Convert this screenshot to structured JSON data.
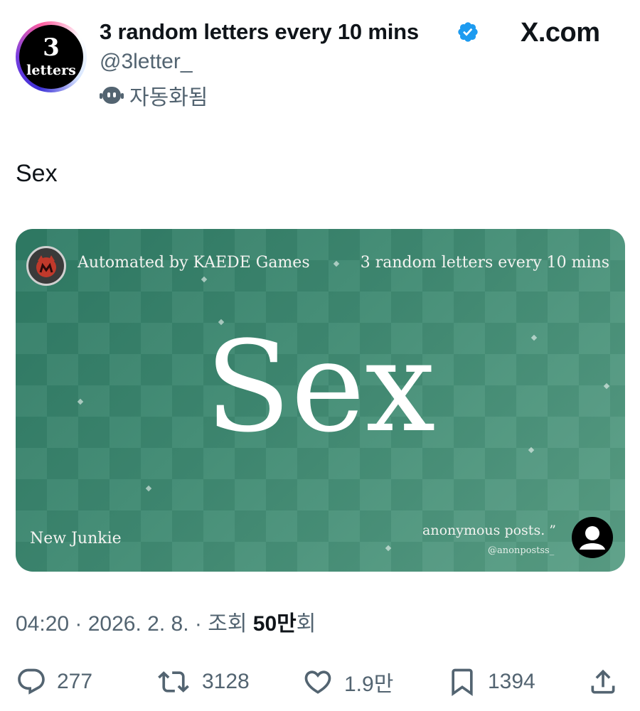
{
  "header": {
    "avatar_number": "3",
    "avatar_word": "letters",
    "display_name": "3 random letters every 10 mins",
    "handle": "@3letter_",
    "automated_label": "자동화됨",
    "brand": "X.com"
  },
  "tweet": {
    "text": "Sex"
  },
  "media": {
    "automated_by": "Automated by KAEDE Games",
    "right_title": "3 random letters every 10 mins",
    "word": "Sex",
    "credit_left": "New Junkie",
    "quote_text": "anonymous posts. ”",
    "quote_handle": "@anonpostss_"
  },
  "meta": {
    "time": "04:20",
    "date": "2026. 2. 8.",
    "views_label": "조회",
    "views_count": "50만",
    "views_suffix": "회"
  },
  "actions": {
    "replies": "277",
    "reposts": "3128",
    "likes": "1.9만",
    "bookmarks": "1394"
  },
  "colors": {
    "verified": "#1d9bf0",
    "card_green": "#3f8a72",
    "muted_text": "#536471"
  }
}
